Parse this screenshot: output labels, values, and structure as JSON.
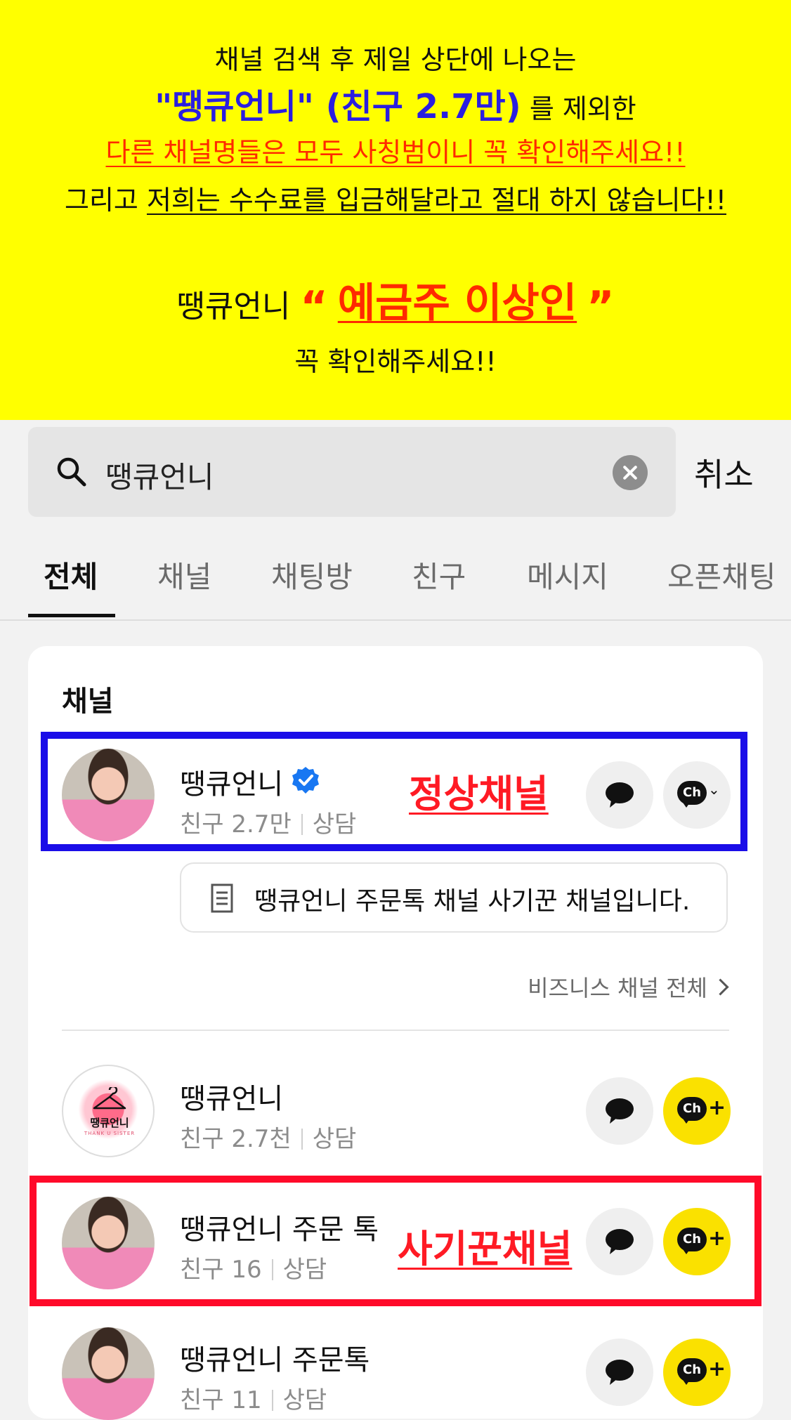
{
  "notice": {
    "line1": "채널 검색 후 제일 상단에 나오는",
    "line2_highlight": "\"땡큐언니\" (친구 2.7만)",
    "line2_rest": "를 제외한",
    "line3": "다른 채널명들은 모두 사칭범이니 꼭 확인해주세요!!",
    "line4_plain": "그리고",
    "line4_underlined": "저희는 수수료를 입금해달라고 절대 하지 않습니다!!",
    "line5_prefix": "땡큐언니",
    "line5_open_quote": "“",
    "line5_name": "예금주 이상인",
    "line5_close_quote": "”",
    "line6": "꼭 확인해주세요!!"
  },
  "search": {
    "query": "땡큐언니",
    "cancel_label": "취소"
  },
  "tabs": [
    "전체",
    "채널",
    "채팅방",
    "친구",
    "메시지",
    "오픈채팅"
  ],
  "section": {
    "title": "채널",
    "channels": [
      {
        "name": "땡큐언니",
        "friends": "친구 2.7만",
        "type": "상담",
        "verified": true,
        "annotation": "정상채널",
        "ch_button": "Ch"
      },
      {
        "name": "땡큐언니",
        "friends": "친구 2.7천",
        "type": "상담",
        "ch_button": "Ch+"
      },
      {
        "name": "땡큐언니 주문 톡",
        "friends": "친구 16",
        "type": "상담",
        "annotation": "사기꾼채널",
        "ch_button": "Ch+"
      },
      {
        "name": "땡큐언니 주문톡",
        "friends": "친구 11",
        "type": "상담",
        "ch_button": "Ch+"
      }
    ],
    "description": "땡큐언니 주문톡 채널 사기꾼 채널입니다.",
    "business_all": "비즈니스 채널 전체"
  },
  "logo": {
    "text": "땡큐언니",
    "subtext": "THANK U SISTER"
  },
  "colors": {
    "notice_bg": "#ffff00",
    "highlight_blue": "#2a1ee0",
    "warning_red": "#ff2a00",
    "kakao_yellow": "#fae100",
    "verified_blue": "#1877f2"
  }
}
